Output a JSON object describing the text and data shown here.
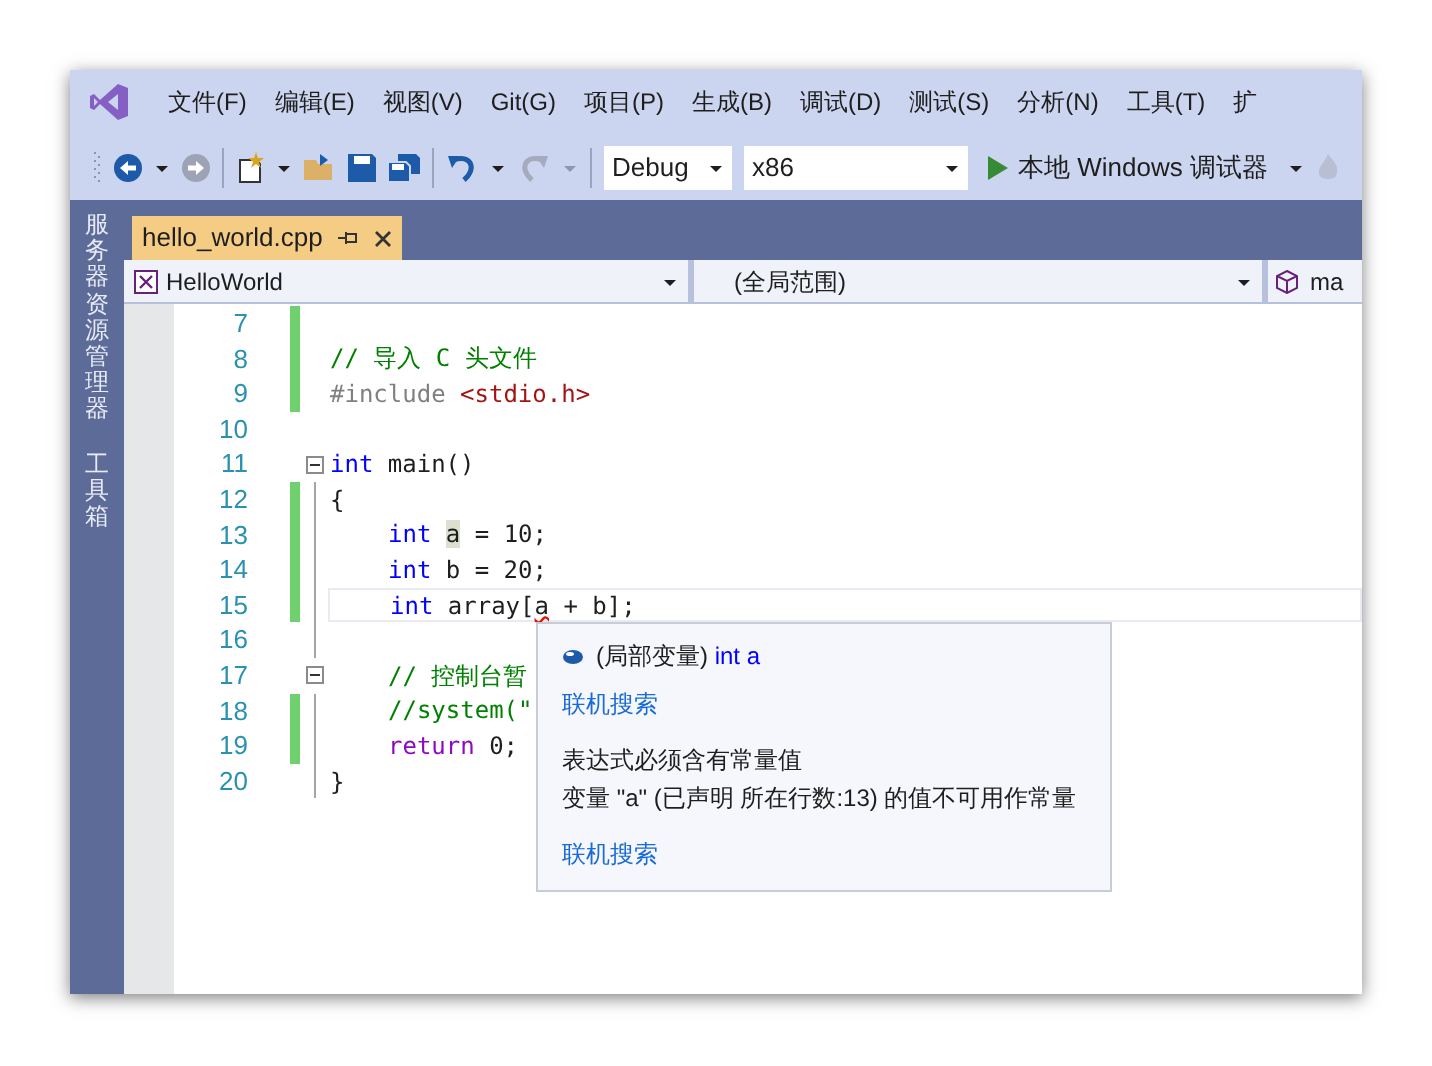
{
  "menu": [
    "文件(F)",
    "编辑(E)",
    "视图(V)",
    "Git(G)",
    "项目(P)",
    "生成(B)",
    "调试(D)",
    "测试(S)",
    "分析(N)",
    "工具(T)",
    "扩"
  ],
  "toolbar": {
    "configuration": "Debug",
    "platform": "x86",
    "run_target": "本地 Windows 调试器"
  },
  "side_tabs": [
    {
      "label": "服务器资源管理器"
    },
    {
      "label": "工具箱"
    }
  ],
  "document_tabs": [
    {
      "label": "hello_world.cpp",
      "selected": true
    }
  ],
  "navigation": {
    "project": "HelloWorld",
    "scope": "(全局范围)",
    "member": "ma"
  },
  "editor": {
    "lines": [
      {
        "number": "7",
        "changed": true,
        "fold": false,
        "current": false,
        "indented": false
      },
      {
        "number": "8",
        "changed": true,
        "fold": false,
        "current": false,
        "indented": false,
        "tokens": [
          {
            "kind": "comment",
            "text": "// 导入 C 头文件"
          }
        ]
      },
      {
        "number": "9",
        "changed": true,
        "fold": false,
        "current": false,
        "indented": false,
        "tokens": [
          {
            "kind": "preproc",
            "text": "#include "
          },
          {
            "kind": "header",
            "text": "<stdio.h>"
          }
        ]
      },
      {
        "number": "10",
        "changed": false,
        "fold": false,
        "current": false,
        "indented": false
      },
      {
        "number": "11",
        "changed": false,
        "fold": true,
        "current": false,
        "indented": false,
        "tokens": [
          {
            "kind": "keyword",
            "text": "int"
          },
          {
            "kind": "plain",
            "text": " main()"
          }
        ]
      },
      {
        "number": "12",
        "changed": true,
        "fold": false,
        "current": false,
        "indented": false,
        "tokens": [
          {
            "kind": "plain",
            "text": "{"
          }
        ]
      },
      {
        "number": "13",
        "changed": true,
        "fold": false,
        "current": false,
        "indented": true,
        "tokens": [
          {
            "kind": "keyword",
            "text": "int "
          },
          {
            "kind": "reference",
            "text": "a"
          },
          {
            "kind": "plain",
            "text": " = 10;"
          }
        ]
      },
      {
        "number": "14",
        "changed": true,
        "fold": false,
        "current": false,
        "indented": true,
        "tokens": [
          {
            "kind": "keyword",
            "text": "int"
          },
          {
            "kind": "plain",
            "text": " b = 20;"
          }
        ]
      },
      {
        "number": "15",
        "changed": true,
        "fold": false,
        "current": true,
        "indented": true,
        "tokens": [
          {
            "kind": "keyword",
            "text": "int"
          },
          {
            "kind": "plain",
            "text": " array["
          },
          {
            "kind": "error",
            "text": "a"
          },
          {
            "kind": "plain",
            "text": " + b];"
          }
        ]
      },
      {
        "number": "16",
        "changed": false,
        "fold": false,
        "current": false,
        "indented": false
      },
      {
        "number": "17",
        "changed": false,
        "fold": true,
        "current": false,
        "indented": true,
        "tokens": [
          {
            "kind": "comment",
            "text": "// 控制台暂"
          }
        ]
      },
      {
        "number": "18",
        "changed": true,
        "fold": false,
        "current": false,
        "indented": true,
        "tokens": [
          {
            "kind": "comment",
            "text": "//system(\""
          }
        ]
      },
      {
        "number": "19",
        "changed": true,
        "fold": false,
        "current": false,
        "indented": true,
        "tokens": [
          {
            "kind": "control",
            "text": "return"
          },
          {
            "kind": "plain",
            "text": " 0;"
          }
        ]
      },
      {
        "number": "20",
        "changed": false,
        "fold": false,
        "current": false,
        "indented": false,
        "tokens": [
          {
            "kind": "plain",
            "text": "}"
          }
        ]
      }
    ]
  },
  "tooltip": {
    "symbol_kind": "(局部变量)",
    "signature": "int a",
    "items": [
      {
        "kind": "link",
        "text": "联机搜索"
      },
      {
        "kind": "message",
        "text": "表达式必须含有常量值"
      },
      {
        "kind": "message",
        "text": "变量 \"a\" (已声明 所在行数:13) 的值不可用作常量"
      },
      {
        "kind": "link",
        "text": "联机搜索"
      }
    ]
  }
}
